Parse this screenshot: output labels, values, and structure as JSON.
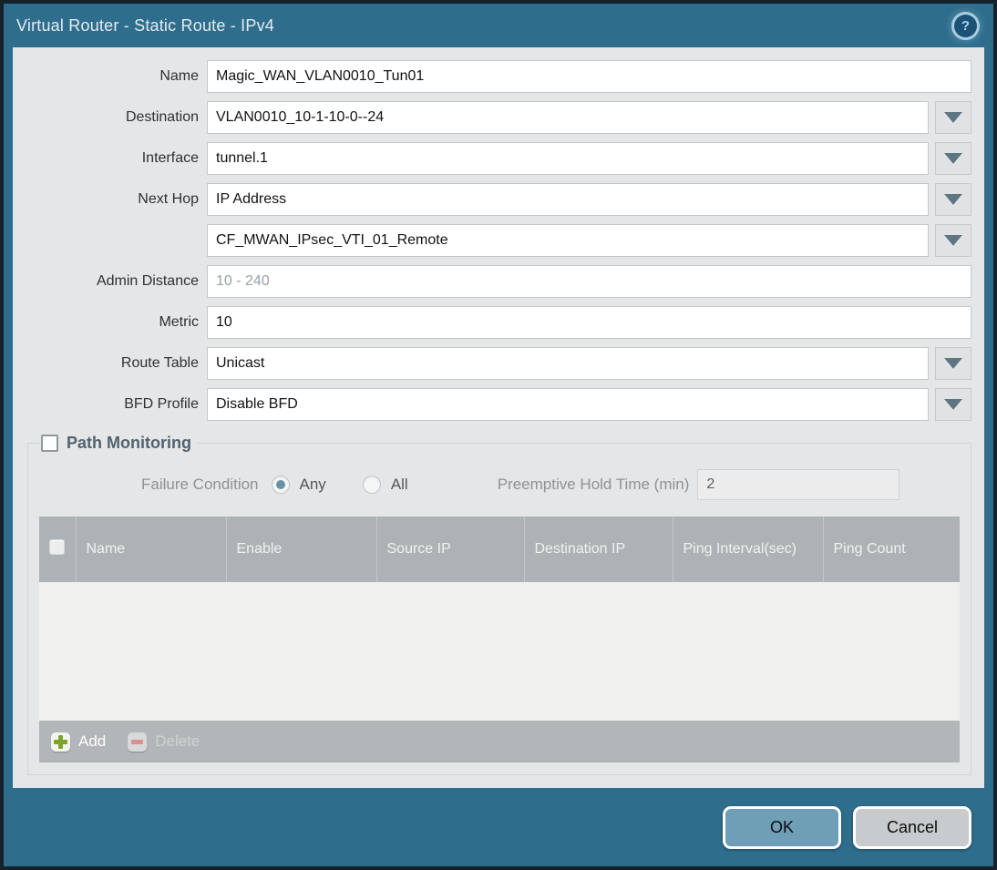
{
  "window": {
    "title": "Virtual Router - Static Route - IPv4",
    "help_glyph": "?"
  },
  "form": {
    "name": {
      "label": "Name",
      "value": "Magic_WAN_VLAN0010_Tun01"
    },
    "destination": {
      "label": "Destination",
      "value": "VLAN0010_10-1-10-0--24"
    },
    "interface": {
      "label": "Interface",
      "value": "tunnel.1"
    },
    "next_hop": {
      "label": "Next Hop",
      "value": "IP Address"
    },
    "next_hop_address": {
      "value": "CF_MWAN_IPsec_VTI_01_Remote"
    },
    "admin_distance": {
      "label": "Admin Distance",
      "value": "",
      "placeholder": "10 - 240"
    },
    "metric": {
      "label": "Metric",
      "value": "10"
    },
    "route_table": {
      "label": "Route Table",
      "value": "Unicast"
    },
    "bfd_profile": {
      "label": "BFD Profile",
      "value": "Disable BFD"
    }
  },
  "path_monitoring": {
    "title": "Path Monitoring",
    "enabled": false,
    "failure_condition": {
      "label": "Failure Condition",
      "options": [
        {
          "label": "Any",
          "selected": true
        },
        {
          "label": "All",
          "selected": false
        }
      ]
    },
    "preemptive_hold_time": {
      "label": "Preemptive Hold Time (min)",
      "value": "2"
    },
    "table": {
      "columns": [
        "Name",
        "Enable",
        "Source IP",
        "Destination IP",
        "Ping Interval(sec)",
        "Ping Count"
      ],
      "rows": []
    },
    "toolbar": {
      "add_label": "Add",
      "delete_label": "Delete"
    }
  },
  "actions": {
    "ok_label": "OK",
    "cancel_label": "Cancel"
  },
  "colors": {
    "titlebar_teal": "#2e6d8b",
    "outer_border_navy": "#15212b",
    "content_gray": "#e5e6e7",
    "table_header_gray": "#adb2b5",
    "ok_button": "#6f9eb7",
    "cancel_button": "#c8cbcd",
    "add_plus_green": "#7da32d",
    "delete_minus_red": "#d98f8f",
    "radio_selected": "#6a92a7"
  }
}
